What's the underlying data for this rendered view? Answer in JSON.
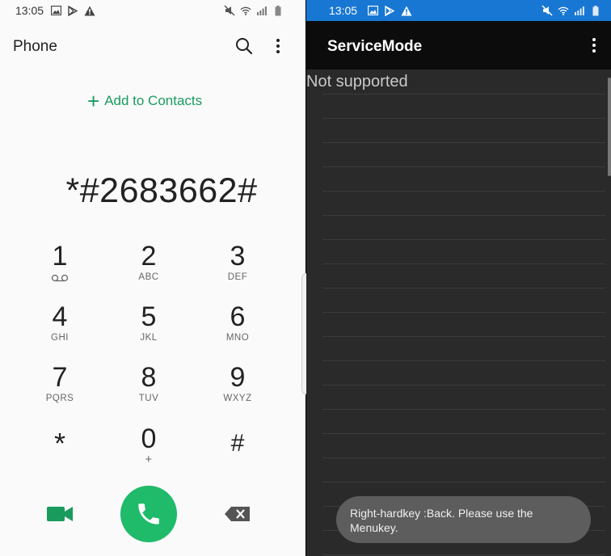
{
  "left": {
    "status": {
      "time": "13:05",
      "icons_left": [
        "image-icon",
        "play-store-icon",
        "warning-icon"
      ],
      "icons_right": [
        "mute-icon",
        "wifi-icon",
        "signal-icon",
        "battery-icon"
      ]
    },
    "app_title": "Phone",
    "add_to_contacts": "Add to Contacts",
    "dialed_number": "*#2683662#",
    "keys": [
      {
        "num": "1",
        "sub": ""
      },
      {
        "num": "2",
        "sub": "ABC"
      },
      {
        "num": "3",
        "sub": "DEF"
      },
      {
        "num": "4",
        "sub": "GHI"
      },
      {
        "num": "5",
        "sub": "JKL"
      },
      {
        "num": "6",
        "sub": "MNO"
      },
      {
        "num": "7",
        "sub": "PQRS"
      },
      {
        "num": "8",
        "sub": "TUV"
      },
      {
        "num": "9",
        "sub": "WXYZ"
      },
      {
        "num": "*",
        "sub": ""
      },
      {
        "num": "0",
        "sub": "+"
      },
      {
        "num": "#",
        "sub": ""
      }
    ],
    "colors": {
      "accent": "#1a9b5e",
      "call": "#1fba6a"
    }
  },
  "right": {
    "status": {
      "time": "13:05",
      "bar_color": "#1877d2"
    },
    "app_title": "ServiceMode",
    "message": "Not supported",
    "toast": "Right-hardkey :Back.   Please use the Menukey."
  }
}
